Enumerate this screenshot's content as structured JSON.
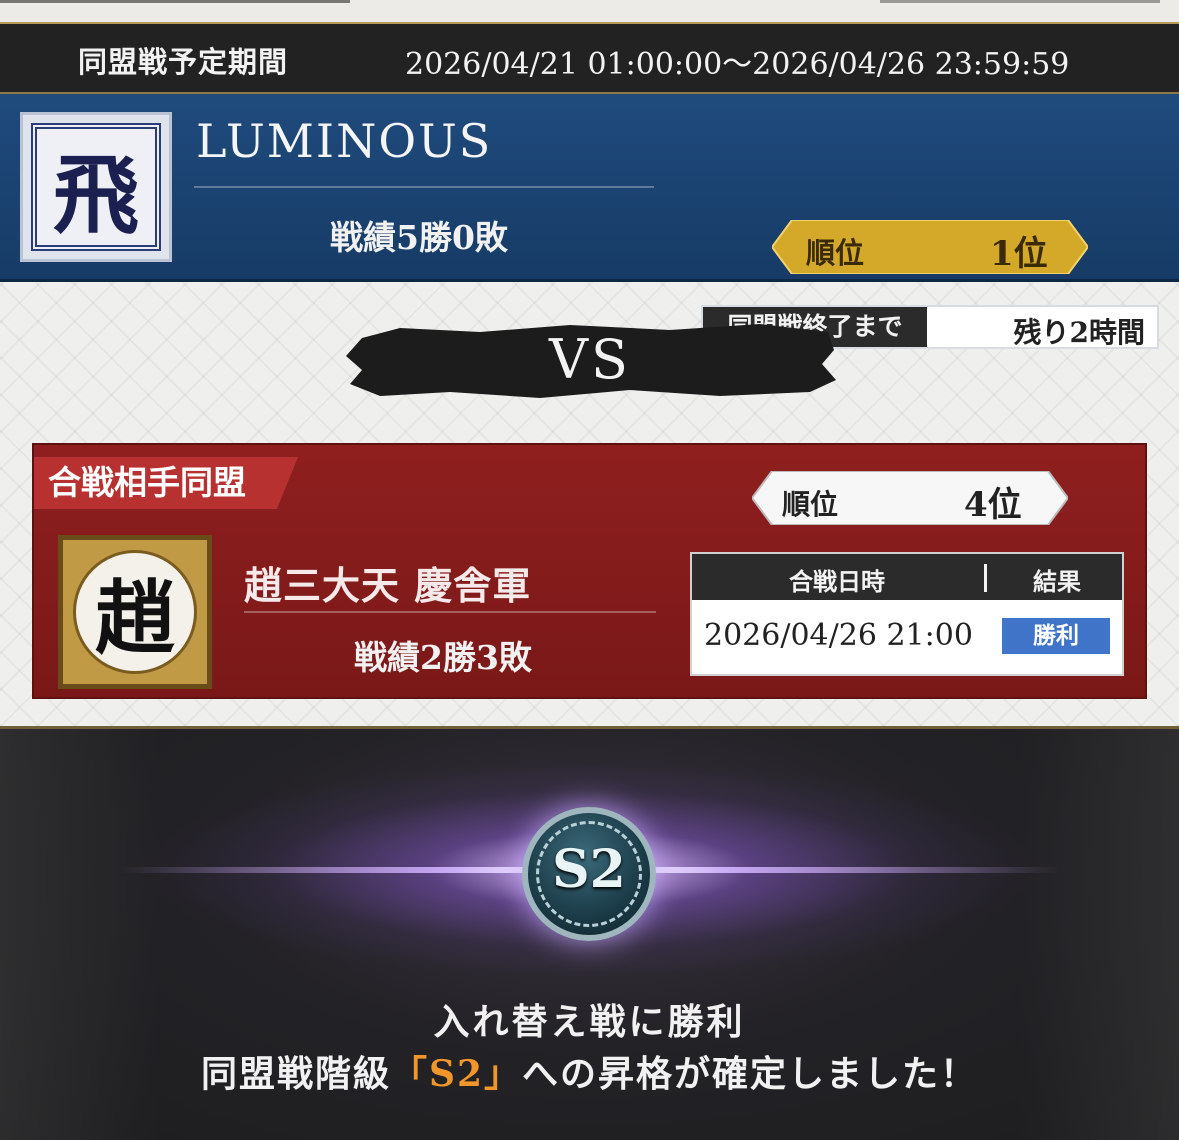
{
  "period": {
    "label": "同盟戦予定期間",
    "value": "2026/04/21 01:00:00～2026/04/26 23:59:59"
  },
  "my_alliance": {
    "emblem_char": "飛",
    "name": "LUMINOUS",
    "record": "戦績5勝0敗",
    "rank_label": "順位",
    "rank_value": "1位",
    "remaining_label": "同盟戦終了まで",
    "remaining_value": "残り2時間"
  },
  "vs_label": "VS",
  "opponent": {
    "tag": "合戦相手同盟",
    "emblem_char": "趙",
    "name": "趙三大天 慶舎軍",
    "record": "戦績2勝3敗",
    "rank_label": "順位",
    "rank_value": "4位",
    "table": {
      "col_datetime": "合戦日時",
      "col_result": "結果",
      "datetime": "2026/04/26 21:00",
      "result": "勝利"
    }
  },
  "promotion": {
    "badge": "S2",
    "line1": "入れ替え戦に勝利",
    "line2_prefix": "同盟戦階級",
    "line2_highlight": "「S2」",
    "line2_suffix": "への昇格が確定しました！"
  },
  "colors": {
    "my_panel": "#1f4b7d",
    "opp_panel": "#8f1f1f",
    "gold_rank": "#d4a829",
    "result_win": "#3f74c9",
    "highlight": "#f0962a"
  }
}
